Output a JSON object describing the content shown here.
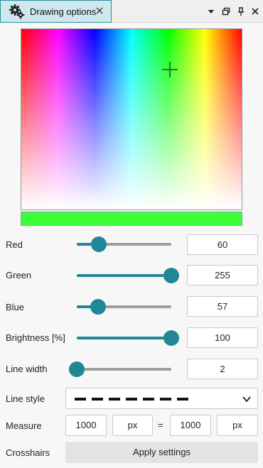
{
  "panel": {
    "title": "Drawing options"
  },
  "picker": {
    "preview_color": "#3cff39"
  },
  "sliders": {
    "red": {
      "label": "Red",
      "value": "60",
      "min": 0,
      "max": 255
    },
    "green": {
      "label": "Green",
      "value": "255",
      "min": 0,
      "max": 255
    },
    "blue": {
      "label": "Blue",
      "value": "57",
      "min": 0,
      "max": 255
    },
    "brightness": {
      "label": "Brightness [%]",
      "value": "100",
      "min": 0,
      "max": 100
    },
    "line_width": {
      "label": "Line width",
      "value": "2",
      "min": 2,
      "max": 20
    }
  },
  "line_style": {
    "label": "Line style",
    "selected": "dashed"
  },
  "measure": {
    "label": "Measure",
    "value1": "1000",
    "unit1": "px",
    "equals": "=",
    "value2": "1000",
    "unit2": "px"
  },
  "crosshairs": {
    "label": "Crosshairs",
    "button": "Apply settings"
  },
  "colors": {
    "accent": "#1f8795",
    "tab_bg": "#cfe8ee"
  }
}
